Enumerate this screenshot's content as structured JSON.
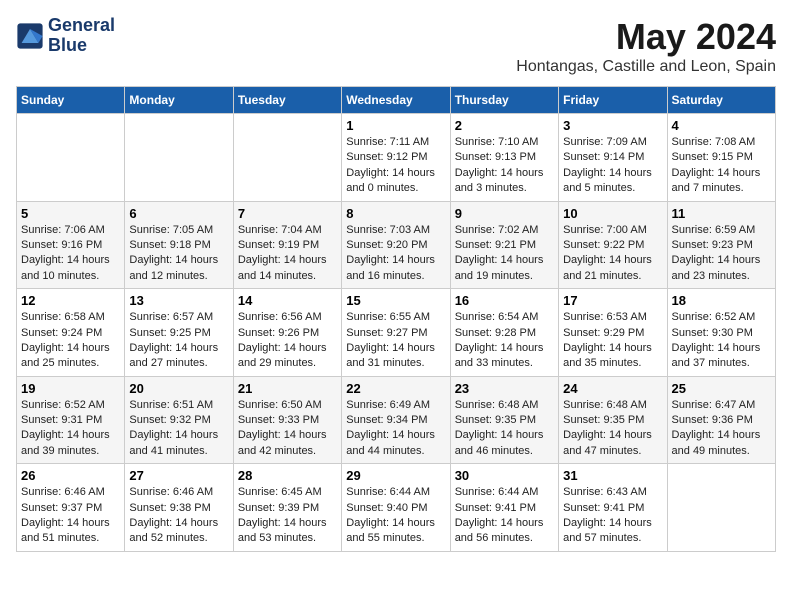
{
  "header": {
    "logo_line1": "General",
    "logo_line2": "Blue",
    "month": "May 2024",
    "location": "Hontangas, Castille and Leon, Spain"
  },
  "weekdays": [
    "Sunday",
    "Monday",
    "Tuesday",
    "Wednesday",
    "Thursday",
    "Friday",
    "Saturday"
  ],
  "weeks": [
    [
      {
        "day": "",
        "info": ""
      },
      {
        "day": "",
        "info": ""
      },
      {
        "day": "",
        "info": ""
      },
      {
        "day": "1",
        "info": "Sunrise: 7:11 AM\nSunset: 9:12 PM\nDaylight: 14 hours and 0 minutes."
      },
      {
        "day": "2",
        "info": "Sunrise: 7:10 AM\nSunset: 9:13 PM\nDaylight: 14 hours and 3 minutes."
      },
      {
        "day": "3",
        "info": "Sunrise: 7:09 AM\nSunset: 9:14 PM\nDaylight: 14 hours and 5 minutes."
      },
      {
        "day": "4",
        "info": "Sunrise: 7:08 AM\nSunset: 9:15 PM\nDaylight: 14 hours and 7 minutes."
      }
    ],
    [
      {
        "day": "5",
        "info": "Sunrise: 7:06 AM\nSunset: 9:16 PM\nDaylight: 14 hours and 10 minutes."
      },
      {
        "day": "6",
        "info": "Sunrise: 7:05 AM\nSunset: 9:18 PM\nDaylight: 14 hours and 12 minutes."
      },
      {
        "day": "7",
        "info": "Sunrise: 7:04 AM\nSunset: 9:19 PM\nDaylight: 14 hours and 14 minutes."
      },
      {
        "day": "8",
        "info": "Sunrise: 7:03 AM\nSunset: 9:20 PM\nDaylight: 14 hours and 16 minutes."
      },
      {
        "day": "9",
        "info": "Sunrise: 7:02 AM\nSunset: 9:21 PM\nDaylight: 14 hours and 19 minutes."
      },
      {
        "day": "10",
        "info": "Sunrise: 7:00 AM\nSunset: 9:22 PM\nDaylight: 14 hours and 21 minutes."
      },
      {
        "day": "11",
        "info": "Sunrise: 6:59 AM\nSunset: 9:23 PM\nDaylight: 14 hours and 23 minutes."
      }
    ],
    [
      {
        "day": "12",
        "info": "Sunrise: 6:58 AM\nSunset: 9:24 PM\nDaylight: 14 hours and 25 minutes."
      },
      {
        "day": "13",
        "info": "Sunrise: 6:57 AM\nSunset: 9:25 PM\nDaylight: 14 hours and 27 minutes."
      },
      {
        "day": "14",
        "info": "Sunrise: 6:56 AM\nSunset: 9:26 PM\nDaylight: 14 hours and 29 minutes."
      },
      {
        "day": "15",
        "info": "Sunrise: 6:55 AM\nSunset: 9:27 PM\nDaylight: 14 hours and 31 minutes."
      },
      {
        "day": "16",
        "info": "Sunrise: 6:54 AM\nSunset: 9:28 PM\nDaylight: 14 hours and 33 minutes."
      },
      {
        "day": "17",
        "info": "Sunrise: 6:53 AM\nSunset: 9:29 PM\nDaylight: 14 hours and 35 minutes."
      },
      {
        "day": "18",
        "info": "Sunrise: 6:52 AM\nSunset: 9:30 PM\nDaylight: 14 hours and 37 minutes."
      }
    ],
    [
      {
        "day": "19",
        "info": "Sunrise: 6:52 AM\nSunset: 9:31 PM\nDaylight: 14 hours and 39 minutes."
      },
      {
        "day": "20",
        "info": "Sunrise: 6:51 AM\nSunset: 9:32 PM\nDaylight: 14 hours and 41 minutes."
      },
      {
        "day": "21",
        "info": "Sunrise: 6:50 AM\nSunset: 9:33 PM\nDaylight: 14 hours and 42 minutes."
      },
      {
        "day": "22",
        "info": "Sunrise: 6:49 AM\nSunset: 9:34 PM\nDaylight: 14 hours and 44 minutes."
      },
      {
        "day": "23",
        "info": "Sunrise: 6:48 AM\nSunset: 9:35 PM\nDaylight: 14 hours and 46 minutes."
      },
      {
        "day": "24",
        "info": "Sunrise: 6:48 AM\nSunset: 9:35 PM\nDaylight: 14 hours and 47 minutes."
      },
      {
        "day": "25",
        "info": "Sunrise: 6:47 AM\nSunset: 9:36 PM\nDaylight: 14 hours and 49 minutes."
      }
    ],
    [
      {
        "day": "26",
        "info": "Sunrise: 6:46 AM\nSunset: 9:37 PM\nDaylight: 14 hours and 51 minutes."
      },
      {
        "day": "27",
        "info": "Sunrise: 6:46 AM\nSunset: 9:38 PM\nDaylight: 14 hours and 52 minutes."
      },
      {
        "day": "28",
        "info": "Sunrise: 6:45 AM\nSunset: 9:39 PM\nDaylight: 14 hours and 53 minutes."
      },
      {
        "day": "29",
        "info": "Sunrise: 6:44 AM\nSunset: 9:40 PM\nDaylight: 14 hours and 55 minutes."
      },
      {
        "day": "30",
        "info": "Sunrise: 6:44 AM\nSunset: 9:41 PM\nDaylight: 14 hours and 56 minutes."
      },
      {
        "day": "31",
        "info": "Sunrise: 6:43 AM\nSunset: 9:41 PM\nDaylight: 14 hours and 57 minutes."
      },
      {
        "day": "",
        "info": ""
      }
    ]
  ]
}
